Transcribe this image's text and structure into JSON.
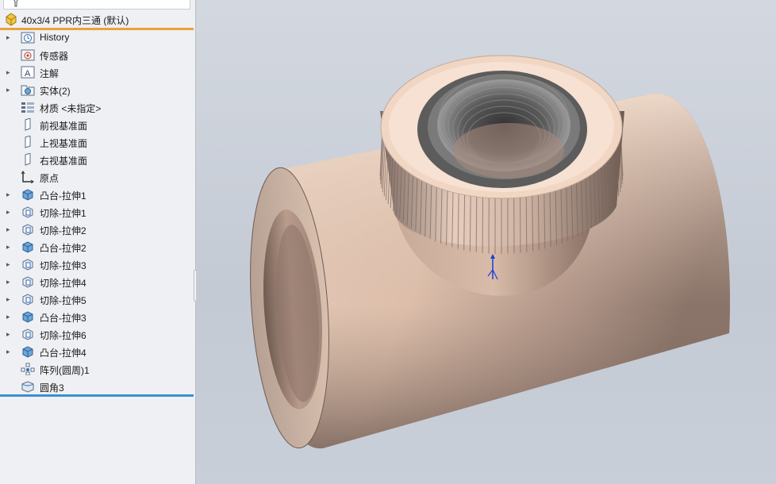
{
  "feature_tree": {
    "root": {
      "label": "40x3/4 PPR内三通  (默认)",
      "icon": "part-icon"
    },
    "items": [
      {
        "label": "History",
        "icon": "history-icon",
        "expandable": true
      },
      {
        "label": "传感器",
        "icon": "sensor-icon",
        "expandable": false
      },
      {
        "label": "注解",
        "icon": "annotation-icon",
        "expandable": true
      },
      {
        "label": "实体(2)",
        "icon": "solid-bodies-icon",
        "expandable": true
      },
      {
        "label": "材质 <未指定>",
        "icon": "material-icon",
        "expandable": false
      },
      {
        "label": "前视基准面",
        "icon": "plane-icon",
        "expandable": false
      },
      {
        "label": "上视基准面",
        "icon": "plane-icon",
        "expandable": false
      },
      {
        "label": "右视基准面",
        "icon": "plane-icon",
        "expandable": false
      },
      {
        "label": "原点",
        "icon": "origin-icon",
        "expandable": false
      },
      {
        "label": "凸台-拉伸1",
        "icon": "boss-extrude-icon",
        "expandable": true
      },
      {
        "label": "切除-拉伸1",
        "icon": "cut-extrude-icon",
        "expandable": true
      },
      {
        "label": "切除-拉伸2",
        "icon": "cut-extrude-icon",
        "expandable": true
      },
      {
        "label": "凸台-拉伸2",
        "icon": "boss-extrude-icon",
        "expandable": true
      },
      {
        "label": "切除-拉伸3",
        "icon": "cut-extrude-icon",
        "expandable": true
      },
      {
        "label": "切除-拉伸4",
        "icon": "cut-extrude-icon",
        "expandable": true
      },
      {
        "label": "切除-拉伸5",
        "icon": "cut-extrude-icon",
        "expandable": true
      },
      {
        "label": "凸台-拉伸3",
        "icon": "boss-extrude-icon",
        "expandable": true
      },
      {
        "label": "切除-拉伸6",
        "icon": "cut-extrude-icon",
        "expandable": true
      },
      {
        "label": "凸台-拉伸4",
        "icon": "boss-extrude-icon",
        "expandable": true
      },
      {
        "label": "阵列(圆周)1",
        "icon": "circular-pattern-icon",
        "expandable": false
      },
      {
        "label": "圆角3",
        "icon": "fillet-icon",
        "expandable": false
      }
    ]
  },
  "colors": {
    "accent_orange": "#e8a33a",
    "accent_blue": "#3a8fcf",
    "part_body": "#e9cdb8",
    "part_shadow": "#8a7468",
    "thread_gray": "#6b6b6b"
  }
}
